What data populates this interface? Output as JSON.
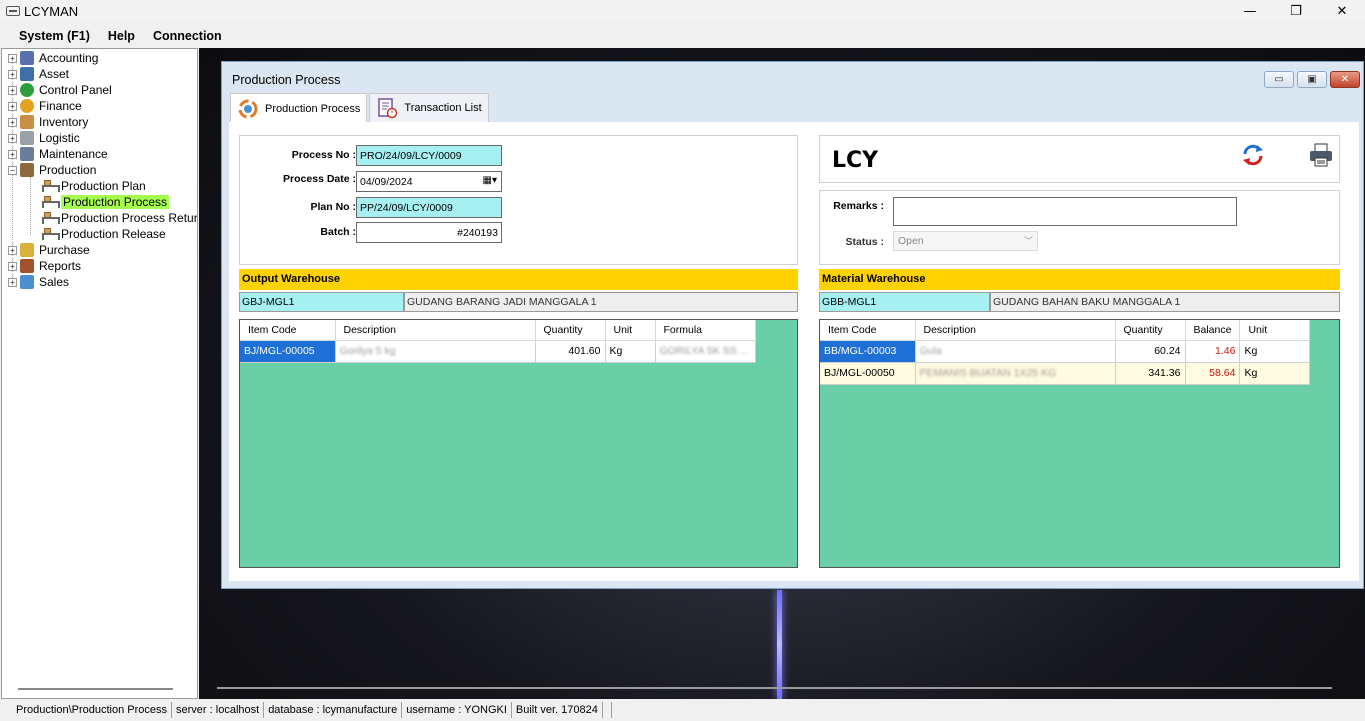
{
  "app": {
    "title": "LCYMAN"
  },
  "window_controls": {
    "minimize": "—",
    "restore": "❐",
    "close": "✕"
  },
  "menu": {
    "system": "System (F1)",
    "help": "Help",
    "connection": "Connection"
  },
  "tree": {
    "items": [
      {
        "label": "Accounting",
        "icon_color": "#5a6fb0"
      },
      {
        "label": "Asset",
        "icon_color": "#3f6fa8"
      },
      {
        "label": "Control Panel",
        "icon_color": "#2e9e3e"
      },
      {
        "label": "Finance",
        "icon_color": "#e4a223"
      },
      {
        "label": "Inventory",
        "icon_color": "#c88f45"
      },
      {
        "label": "Logistic",
        "icon_color": "#9aa0a8"
      },
      {
        "label": "Maintenance",
        "icon_color": "#6b7d9a"
      },
      {
        "label": "Production",
        "icon_color": "#8c6a3d"
      },
      {
        "label": "Purchase",
        "icon_color": "#d9b23a"
      },
      {
        "label": "Reports",
        "icon_color": "#a0522d"
      },
      {
        "label": "Sales",
        "icon_color": "#4a8fd0"
      }
    ],
    "production_children": [
      "Production Plan",
      "Production Process",
      "Production Process Return",
      "Production Release"
    ],
    "selected": "Production Process"
  },
  "child_window": {
    "title": "Production Process",
    "buttons": {
      "minimize": "▭",
      "maximize": "▣",
      "close": "✕"
    },
    "tabs": [
      {
        "label": "Production Process",
        "icon": "production-process-icon"
      },
      {
        "label": "Transaction List",
        "icon": "transaction-list-icon"
      }
    ]
  },
  "form": {
    "process_no_label": "Process No :",
    "process_no": "PRO/24/09/LCY/0009",
    "process_date_label": "Process Date :",
    "process_date": "04/09/2024",
    "plan_no_label": "Plan No :",
    "plan_no": "PP/24/09/LCY/0009",
    "batch_label": "Batch :",
    "batch": "#240193",
    "company": "LCY",
    "remarks_label": "Remarks :",
    "remarks": "",
    "status_label": "Status :",
    "status": "Open"
  },
  "output_warehouse": {
    "header": "Output Warehouse",
    "code": "GBJ-MGL1",
    "name": "GUDANG BARANG JADI MANGGALA 1",
    "columns": [
      "Item Code",
      "Description",
      "Quantity",
      "Unit",
      "Formula"
    ],
    "rows": [
      {
        "item_code": "BJ/MGL-00005",
        "description": "Gorilya 5 kg",
        "quantity": "401.60",
        "unit": "Kg",
        "formula": "GORILYA 5K SS ..."
      }
    ]
  },
  "material_warehouse": {
    "header": "Material Warehouse",
    "code": "GBB-MGL1",
    "name": "GUDANG BAHAN BAKU MANGGALA 1",
    "columns": [
      "Item Code",
      "Description",
      "Quantity",
      "Balance",
      "Unit"
    ],
    "rows": [
      {
        "item_code": "BB/MGL-00003",
        "description": "Gula",
        "quantity": "60.24",
        "balance": "1.46",
        "unit": "Kg"
      },
      {
        "item_code": "BJ/MGL-00050",
        "description": "PEMANIS BUATAN 1X25 KG",
        "quantity": "341.36",
        "balance": "58.64",
        "unit": "Kg"
      }
    ]
  },
  "statusbar": {
    "path": "Production\\Production Process",
    "server": "server : localhost",
    "database": "database : lcymanufacture",
    "username": "username : YONGKI",
    "build": "Built ver. 170824"
  },
  "colors": {
    "grid_bg": "#69cfa7",
    "section_header": "#ffd200",
    "cyan_field": "#a6f0f2",
    "selection": "#1e6fd6",
    "highlight_tree": "#a5ff4f",
    "balance_red": "#d01010"
  }
}
